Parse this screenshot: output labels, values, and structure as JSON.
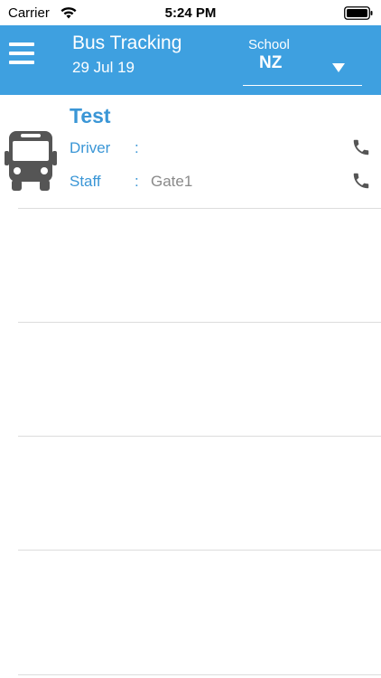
{
  "status_bar": {
    "carrier": "Carrier",
    "time": "5:24 PM"
  },
  "header": {
    "title": "Bus Tracking",
    "date": "29 Jul 19",
    "school": {
      "label": "School",
      "value": "NZ"
    }
  },
  "buses": [
    {
      "name": "Test",
      "driver_label": "Driver",
      "driver_value": "",
      "staff_label": "Staff",
      "staff_value": "Gate1"
    }
  ],
  "colors": {
    "header_bg": "#3ea0e0",
    "accent_text": "#3a96d6",
    "value_text": "#8a8a8a",
    "icon_gray": "#555555"
  },
  "icons": [
    "wifi-icon",
    "battery-icon",
    "menu-icon",
    "chevron-down-icon",
    "bus-icon",
    "phone-icon"
  ]
}
